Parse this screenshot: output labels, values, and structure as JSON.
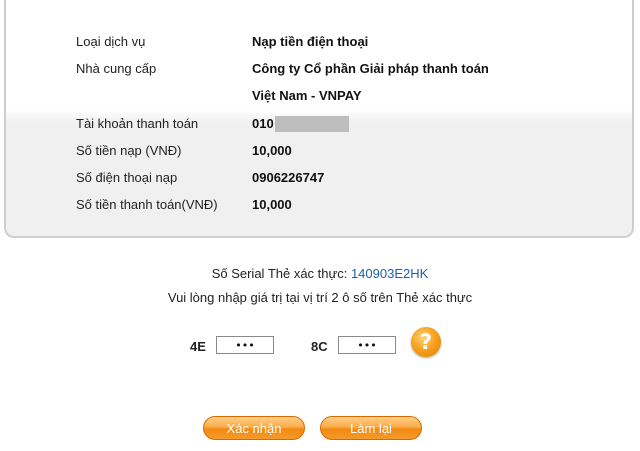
{
  "details": {
    "service_type_label": "Loại dịch vụ",
    "service_type_value": "Nạp tiền điện thoại",
    "provider_label": "Nhà cung cấp",
    "provider_value_line1": "Công ty Cổ phần Giải pháp thanh toán",
    "provider_value_line2": "Việt Nam - VNPAY",
    "account_label": "Tài khoản thanh toán",
    "account_value": "010",
    "topup_amount_label": "Số tiền nạp (VNĐ)",
    "topup_amount_value": "10,000",
    "phone_label": "Số điện thoại nạp",
    "phone_value": "0906226747",
    "payment_amount_label": "Số tiền thanh toán(VNĐ)",
    "payment_amount_value": "10,000"
  },
  "auth": {
    "serial_label": "Số Serial Thẻ xác thực:",
    "serial_value": "140903E2HK",
    "instruction": "Vui lòng nhập giá trị tại vị trí 2 ô số trên Thẻ xác thực",
    "code1_label": "4E",
    "code1_value": "•••",
    "code2_label": "8C",
    "code2_value": "•••",
    "help_glyph": "?"
  },
  "buttons": {
    "confirm_label": "Xác nhận",
    "reset_label": "Làm lại"
  },
  "colors": {
    "accent_orange": "#f59a2a",
    "link_blue": "#1f5fa8"
  }
}
